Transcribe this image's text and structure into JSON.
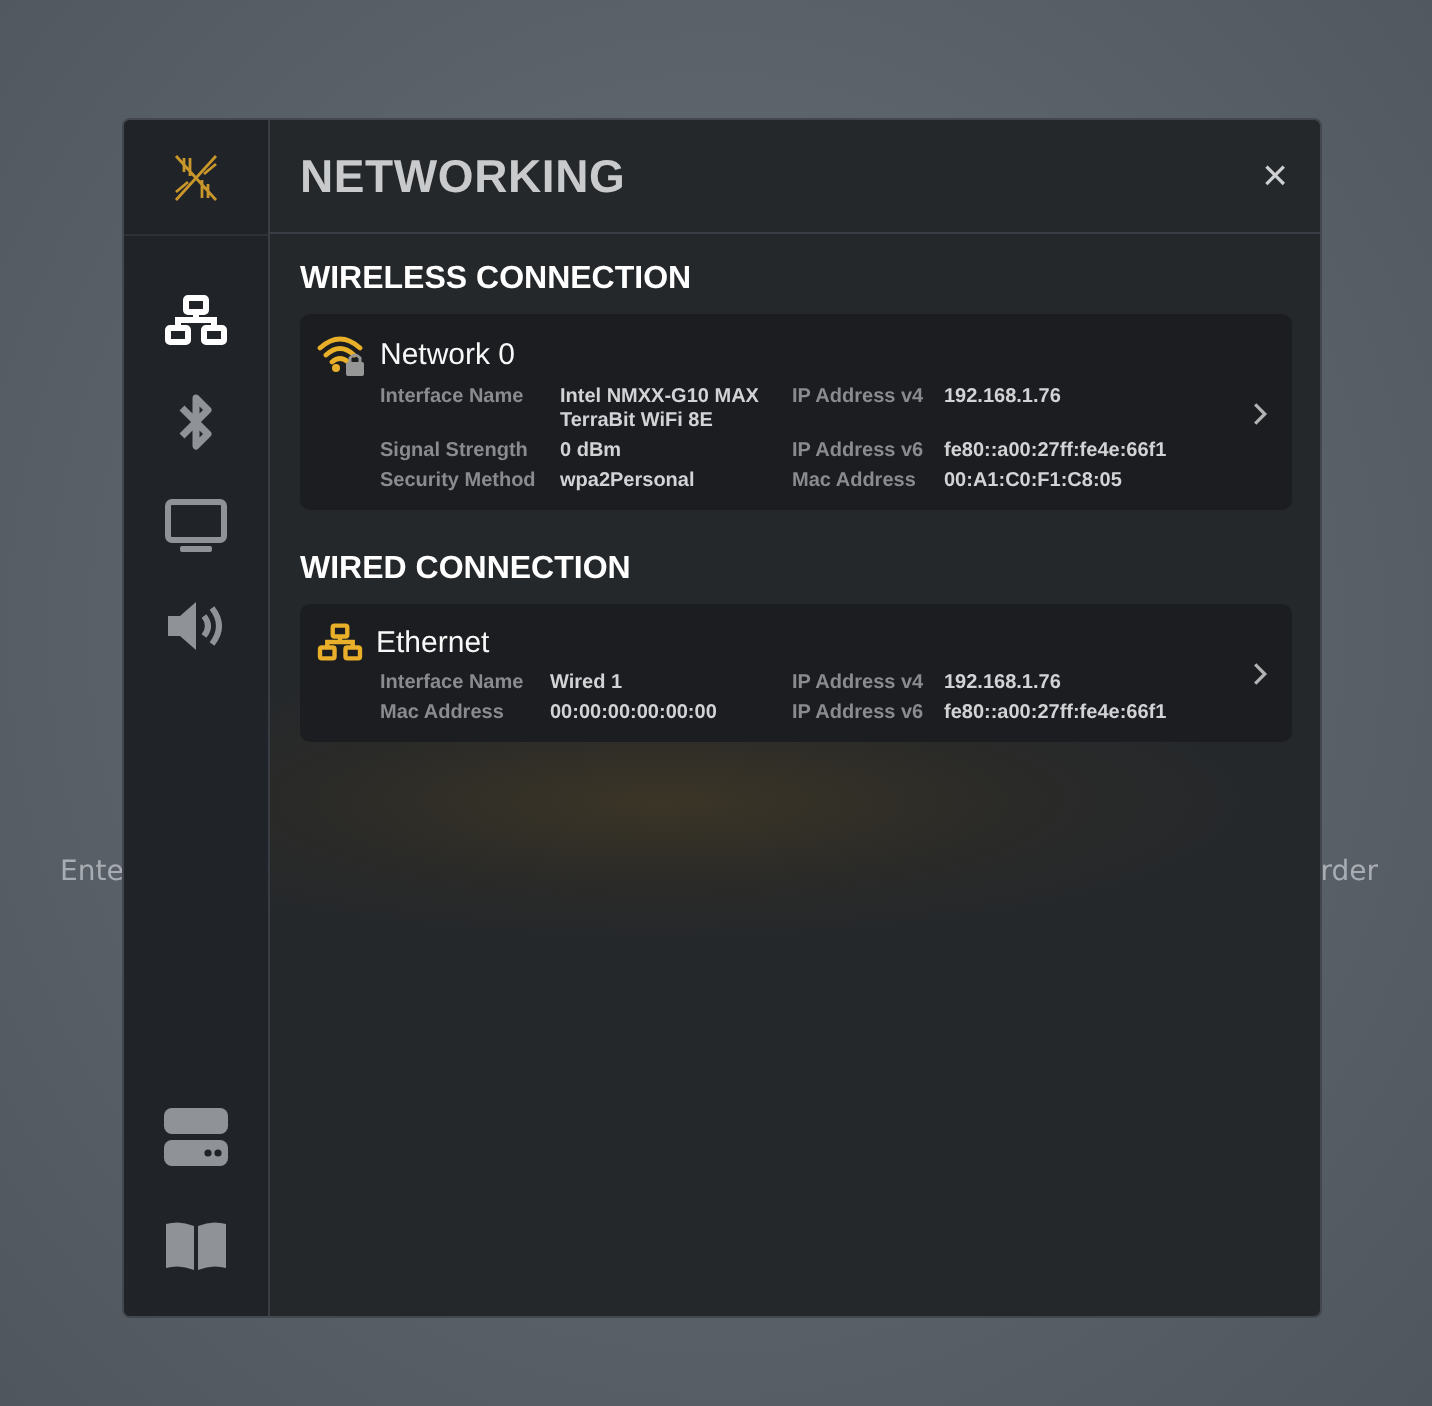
{
  "background_texts": [
    "Ente",
    "rder"
  ],
  "dialog": {
    "title": "NETWORKING",
    "close": "×"
  },
  "sidebar": {
    "items": [
      {
        "kind": "network",
        "selected": true
      },
      {
        "kind": "bluetooth",
        "selected": false
      },
      {
        "kind": "display",
        "selected": false
      },
      {
        "kind": "sound",
        "selected": false
      }
    ],
    "bottom_items": [
      {
        "kind": "storage",
        "selected": false
      },
      {
        "kind": "book",
        "selected": false
      }
    ]
  },
  "sections": [
    {
      "heading": "WIRELESS CONNECTION",
      "cards": [
        {
          "kind": "wifi",
          "name": "Network 0",
          "fields": [
            {
              "label": "Interface Name",
              "value": "Intel NMXX-G10 MAX TerraBit WiFi 8E"
            },
            {
              "label": "IP Address v4",
              "value": "192.168.1.76"
            },
            {
              "label": "Signal Strength",
              "value": "0 dBm"
            },
            {
              "label": "IP Address v6",
              "value": "fe80::a00:27ff:fe4e:66f1"
            },
            {
              "label": "Security Method",
              "value": "wpa2Personal"
            },
            {
              "label": "Mac Address",
              "value": "00:A1:C0:F1:C8:05"
            }
          ]
        }
      ]
    },
    {
      "heading": "WIRED CONNECTION",
      "cards": [
        {
          "kind": "ethernet",
          "name": "Ethernet",
          "fields": [
            {
              "label": "Interface Name",
              "value": "Wired 1"
            },
            {
              "label": "IP Address v4",
              "value": "192.168.1.76"
            },
            {
              "label": "Mac Address",
              "value": "00:00:00:00:00:00"
            },
            {
              "label": "IP Address v6",
              "value": "fe80::a00:27ff:fe4e:66f1"
            }
          ]
        }
      ]
    }
  ]
}
